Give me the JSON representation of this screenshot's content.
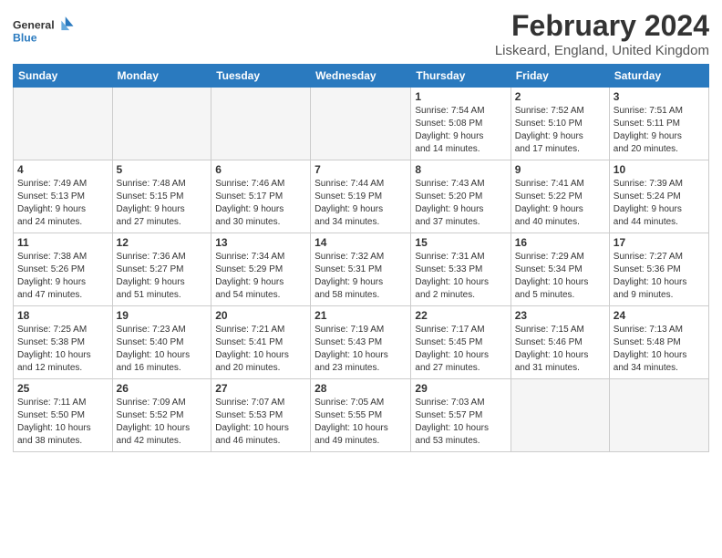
{
  "logo": {
    "line1": "General",
    "line2": "Blue"
  },
  "title": "February 2024",
  "subtitle": "Liskeard, England, United Kingdom",
  "days_of_week": [
    "Sunday",
    "Monday",
    "Tuesday",
    "Wednesday",
    "Thursday",
    "Friday",
    "Saturday"
  ],
  "weeks": [
    [
      {
        "date": "",
        "info": ""
      },
      {
        "date": "",
        "info": ""
      },
      {
        "date": "",
        "info": ""
      },
      {
        "date": "",
        "info": ""
      },
      {
        "date": "1",
        "info": "Sunrise: 7:54 AM\nSunset: 5:08 PM\nDaylight: 9 hours\nand 14 minutes."
      },
      {
        "date": "2",
        "info": "Sunrise: 7:52 AM\nSunset: 5:10 PM\nDaylight: 9 hours\nand 17 minutes."
      },
      {
        "date": "3",
        "info": "Sunrise: 7:51 AM\nSunset: 5:11 PM\nDaylight: 9 hours\nand 20 minutes."
      }
    ],
    [
      {
        "date": "4",
        "info": "Sunrise: 7:49 AM\nSunset: 5:13 PM\nDaylight: 9 hours\nand 24 minutes."
      },
      {
        "date": "5",
        "info": "Sunrise: 7:48 AM\nSunset: 5:15 PM\nDaylight: 9 hours\nand 27 minutes."
      },
      {
        "date": "6",
        "info": "Sunrise: 7:46 AM\nSunset: 5:17 PM\nDaylight: 9 hours\nand 30 minutes."
      },
      {
        "date": "7",
        "info": "Sunrise: 7:44 AM\nSunset: 5:19 PM\nDaylight: 9 hours\nand 34 minutes."
      },
      {
        "date": "8",
        "info": "Sunrise: 7:43 AM\nSunset: 5:20 PM\nDaylight: 9 hours\nand 37 minutes."
      },
      {
        "date": "9",
        "info": "Sunrise: 7:41 AM\nSunset: 5:22 PM\nDaylight: 9 hours\nand 40 minutes."
      },
      {
        "date": "10",
        "info": "Sunrise: 7:39 AM\nSunset: 5:24 PM\nDaylight: 9 hours\nand 44 minutes."
      }
    ],
    [
      {
        "date": "11",
        "info": "Sunrise: 7:38 AM\nSunset: 5:26 PM\nDaylight: 9 hours\nand 47 minutes."
      },
      {
        "date": "12",
        "info": "Sunrise: 7:36 AM\nSunset: 5:27 PM\nDaylight: 9 hours\nand 51 minutes."
      },
      {
        "date": "13",
        "info": "Sunrise: 7:34 AM\nSunset: 5:29 PM\nDaylight: 9 hours\nand 54 minutes."
      },
      {
        "date": "14",
        "info": "Sunrise: 7:32 AM\nSunset: 5:31 PM\nDaylight: 9 hours\nand 58 minutes."
      },
      {
        "date": "15",
        "info": "Sunrise: 7:31 AM\nSunset: 5:33 PM\nDaylight: 10 hours\nand 2 minutes."
      },
      {
        "date": "16",
        "info": "Sunrise: 7:29 AM\nSunset: 5:34 PM\nDaylight: 10 hours\nand 5 minutes."
      },
      {
        "date": "17",
        "info": "Sunrise: 7:27 AM\nSunset: 5:36 PM\nDaylight: 10 hours\nand 9 minutes."
      }
    ],
    [
      {
        "date": "18",
        "info": "Sunrise: 7:25 AM\nSunset: 5:38 PM\nDaylight: 10 hours\nand 12 minutes."
      },
      {
        "date": "19",
        "info": "Sunrise: 7:23 AM\nSunset: 5:40 PM\nDaylight: 10 hours\nand 16 minutes."
      },
      {
        "date": "20",
        "info": "Sunrise: 7:21 AM\nSunset: 5:41 PM\nDaylight: 10 hours\nand 20 minutes."
      },
      {
        "date": "21",
        "info": "Sunrise: 7:19 AM\nSunset: 5:43 PM\nDaylight: 10 hours\nand 23 minutes."
      },
      {
        "date": "22",
        "info": "Sunrise: 7:17 AM\nSunset: 5:45 PM\nDaylight: 10 hours\nand 27 minutes."
      },
      {
        "date": "23",
        "info": "Sunrise: 7:15 AM\nSunset: 5:46 PM\nDaylight: 10 hours\nand 31 minutes."
      },
      {
        "date": "24",
        "info": "Sunrise: 7:13 AM\nSunset: 5:48 PM\nDaylight: 10 hours\nand 34 minutes."
      }
    ],
    [
      {
        "date": "25",
        "info": "Sunrise: 7:11 AM\nSunset: 5:50 PM\nDaylight: 10 hours\nand 38 minutes."
      },
      {
        "date": "26",
        "info": "Sunrise: 7:09 AM\nSunset: 5:52 PM\nDaylight: 10 hours\nand 42 minutes."
      },
      {
        "date": "27",
        "info": "Sunrise: 7:07 AM\nSunset: 5:53 PM\nDaylight: 10 hours\nand 46 minutes."
      },
      {
        "date": "28",
        "info": "Sunrise: 7:05 AM\nSunset: 5:55 PM\nDaylight: 10 hours\nand 49 minutes."
      },
      {
        "date": "29",
        "info": "Sunrise: 7:03 AM\nSunset: 5:57 PM\nDaylight: 10 hours\nand 53 minutes."
      },
      {
        "date": "",
        "info": ""
      },
      {
        "date": "",
        "info": ""
      }
    ]
  ]
}
